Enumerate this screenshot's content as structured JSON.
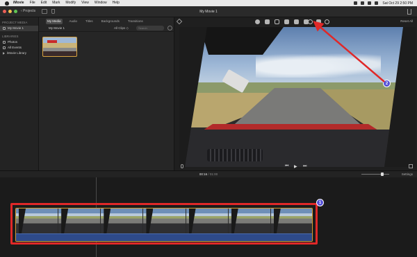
{
  "menubar": {
    "app_name": "iMovie",
    "items": [
      "File",
      "Edit",
      "Mark",
      "Modify",
      "View",
      "Window",
      "Help"
    ],
    "clock": "Sat Oct 29 2:50 PM"
  },
  "titlebar": {
    "projects_label": "‹ Projects",
    "window_title": "My Movie 1"
  },
  "sidebar": {
    "project_media_heading": "PROJECT MEDIA",
    "project_item": "My Movie 1",
    "libraries_heading": "LIBRARIES",
    "library_items": [
      "Photos",
      "All Events",
      "iMovie Library"
    ]
  },
  "browser": {
    "tabs": [
      "My Media",
      "Audio",
      "Titles",
      "Backgrounds",
      "Transitions"
    ],
    "active_tab": "My Media",
    "event_title": "My Movie 1",
    "filter": "All Clips ◇",
    "search_placeholder": "Search"
  },
  "viewer": {
    "reset_all_label": "Reset All",
    "play_controls": {
      "prev": "⏮",
      "play": "▶",
      "next": "⏭"
    }
  },
  "timeline": {
    "current_time": "00:16",
    "total_time": "01:00",
    "settings_label": "Settings"
  },
  "annotations": {
    "badge_1": "1",
    "badge_2": "2"
  },
  "colors": {
    "annotation_red": "#e02828",
    "badge_purple": "#5450d8",
    "clip_border": "#d39a30",
    "audio_track": "#2e4a8a"
  }
}
